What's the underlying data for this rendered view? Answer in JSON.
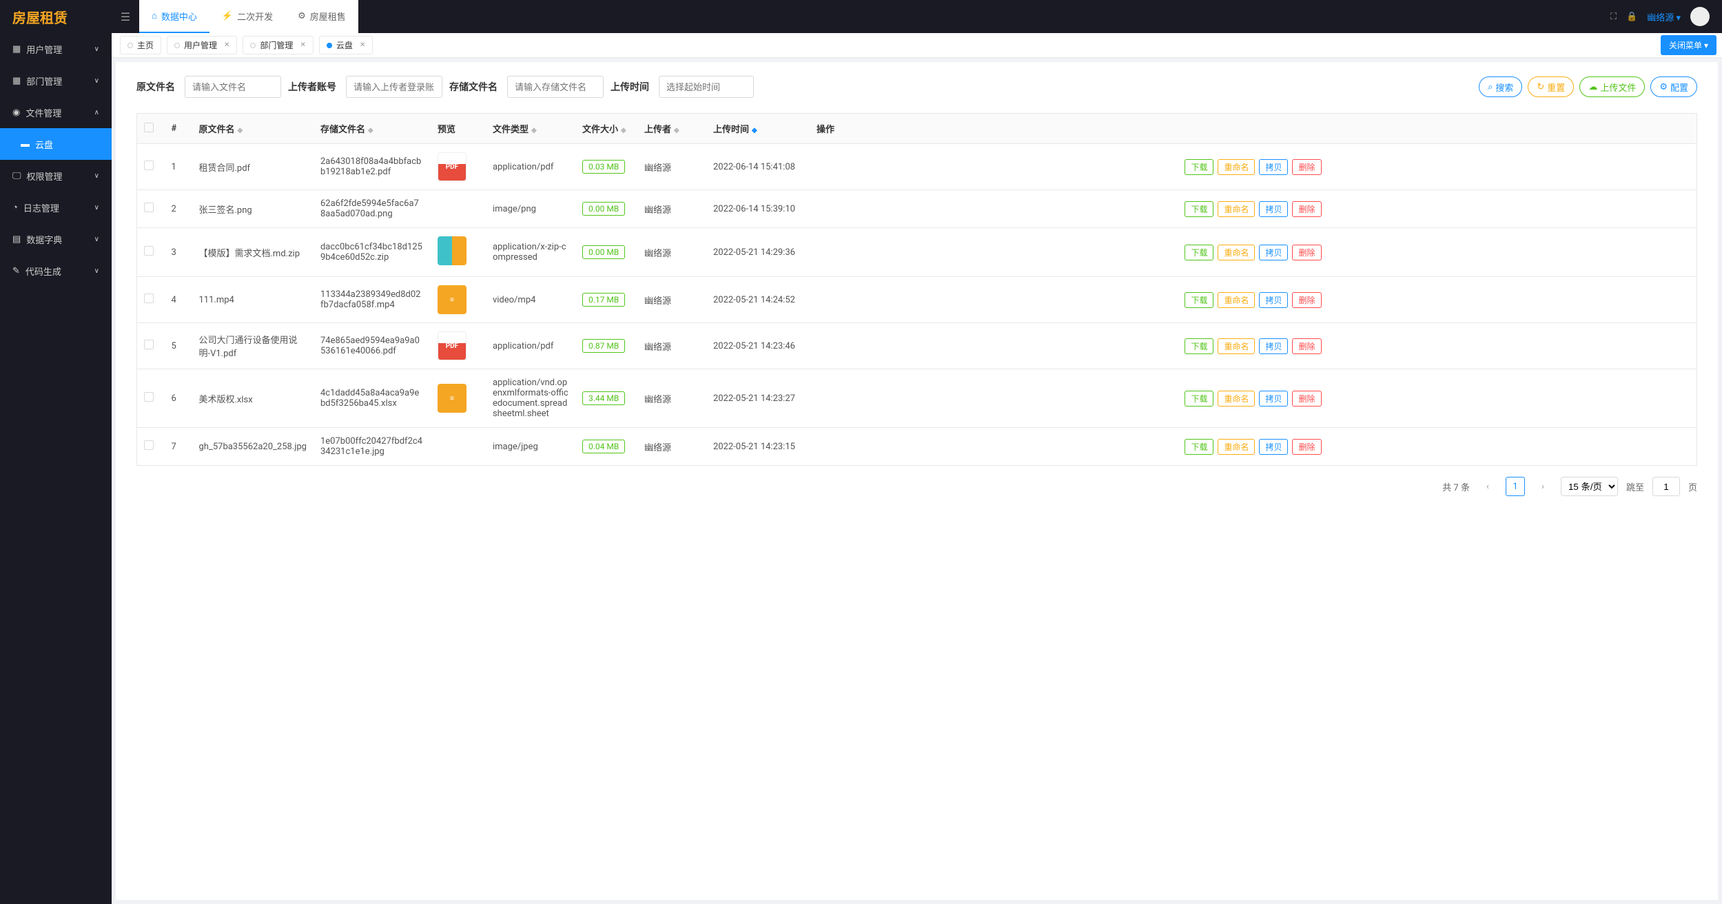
{
  "app": {
    "title": "房屋租赁"
  },
  "header_tabs": [
    {
      "label": "数据中心",
      "active": true
    },
    {
      "label": "二次开发",
      "active": false
    },
    {
      "label": "房屋租售",
      "active": false
    }
  ],
  "header": {
    "username": "幽络源"
  },
  "sidebar": {
    "items": [
      {
        "icon": "users",
        "label": "用户管理",
        "expanded": false
      },
      {
        "icon": "dept",
        "label": "部门管理",
        "expanded": false
      },
      {
        "icon": "file",
        "label": "文件管理",
        "expanded": true,
        "children": [
          {
            "icon": "folder",
            "label": "云盘",
            "active": true
          }
        ]
      },
      {
        "icon": "perm",
        "label": "权限管理",
        "expanded": false
      },
      {
        "icon": "log",
        "label": "日志管理",
        "expanded": false
      },
      {
        "icon": "dict",
        "label": "数据字典",
        "expanded": false
      },
      {
        "icon": "code",
        "label": "代码生成",
        "expanded": false
      }
    ]
  },
  "tabs": [
    {
      "label": "主页",
      "closable": false,
      "active": false
    },
    {
      "label": "用户管理",
      "closable": true,
      "active": false
    },
    {
      "label": "部门管理",
      "closable": true,
      "active": false
    },
    {
      "label": "云盘",
      "closable": true,
      "active": true
    }
  ],
  "close_menu_label": "关闭菜单 ▾",
  "filters": {
    "orig_label": "原文件名",
    "orig_placeholder": "请输入文件名",
    "uploader_label": "上传者账号",
    "uploader_placeholder": "请输入上传者登录账号",
    "store_label": "存储文件名",
    "store_placeholder": "请输入存储文件名",
    "time_label": "上传时间",
    "time_placeholder": "选择起始时间"
  },
  "filter_actions": {
    "search": "搜索",
    "reset": "重置",
    "upload": "上传文件",
    "config": "配置"
  },
  "table": {
    "headers": {
      "index": "#",
      "orig": "原文件名",
      "store": "存储文件名",
      "preview": "预览",
      "type": "文件类型",
      "size": "文件大小",
      "uploader": "上传者",
      "time": "上传时间",
      "ops": "操作"
    },
    "row_actions": {
      "download": "下载",
      "rename": "重命名",
      "copy": "拷贝",
      "delete": "删除"
    },
    "rows": [
      {
        "idx": "1",
        "orig": "租赁合同.pdf",
        "store": "2a643018f08a4a4bbfacbb19218ab1e2.pdf",
        "preview": "pdf",
        "type": "application/pdf",
        "size": "0.03 MB",
        "uploader": "幽络源",
        "time": "2022-06-14 15:41:08"
      },
      {
        "idx": "2",
        "orig": "张三签名.png",
        "store": "62a6f2fde5994e5fac6a78aa5ad070ad.png",
        "preview": "",
        "type": "image/png",
        "size": "0.00 MB",
        "uploader": "幽络源",
        "time": "2022-06-14 15:39:10"
      },
      {
        "idx": "3",
        "orig": "【模版】需求文档.md.zip",
        "store": "dacc0bc61cf34bc18d1259b4ce60d52c.zip",
        "preview": "zip",
        "type": "application/x-zip-compressed",
        "size": "0.00 MB",
        "uploader": "幽络源",
        "time": "2022-05-21 14:29:36"
      },
      {
        "idx": "4",
        "orig": "111.mp4",
        "store": "113344a2389349ed8d02fb7dacfa058f.mp4",
        "preview": "doc",
        "type": "video/mp4",
        "size": "0.17 MB",
        "uploader": "幽络源",
        "time": "2022-05-21 14:24:52"
      },
      {
        "idx": "5",
        "orig": "公司大门通行设备使用说明-V1.pdf",
        "store": "74e865aed9594ea9a9a0536161e40066.pdf",
        "preview": "pdf",
        "type": "application/pdf",
        "size": "0.87 MB",
        "uploader": "幽络源",
        "time": "2022-05-21 14:23:46"
      },
      {
        "idx": "6",
        "orig": "美术版权.xlsx",
        "store": "4c1dadd45a8a4aca9a9ebd5f3256ba45.xlsx",
        "preview": "doc",
        "type": "application/vnd.openxmlformats-officedocument.spreadsheetml.sheet",
        "size": "3.44 MB",
        "uploader": "幽络源",
        "time": "2022-05-21 14:23:27"
      },
      {
        "idx": "7",
        "orig": "gh_57ba35562a20_258.jpg",
        "store": "1e07b00ffc20427fbdf2c434231c1e1e.jpg",
        "preview": "",
        "type": "image/jpeg",
        "size": "0.04 MB",
        "uploader": "幽络源",
        "time": "2022-05-21 14:23:15"
      }
    ]
  },
  "pagination": {
    "total_text": "共 7 条",
    "current": "1",
    "page_size": "15 条/页",
    "jump_label": "跳至",
    "jump_value": "1",
    "page_suffix": "页"
  }
}
